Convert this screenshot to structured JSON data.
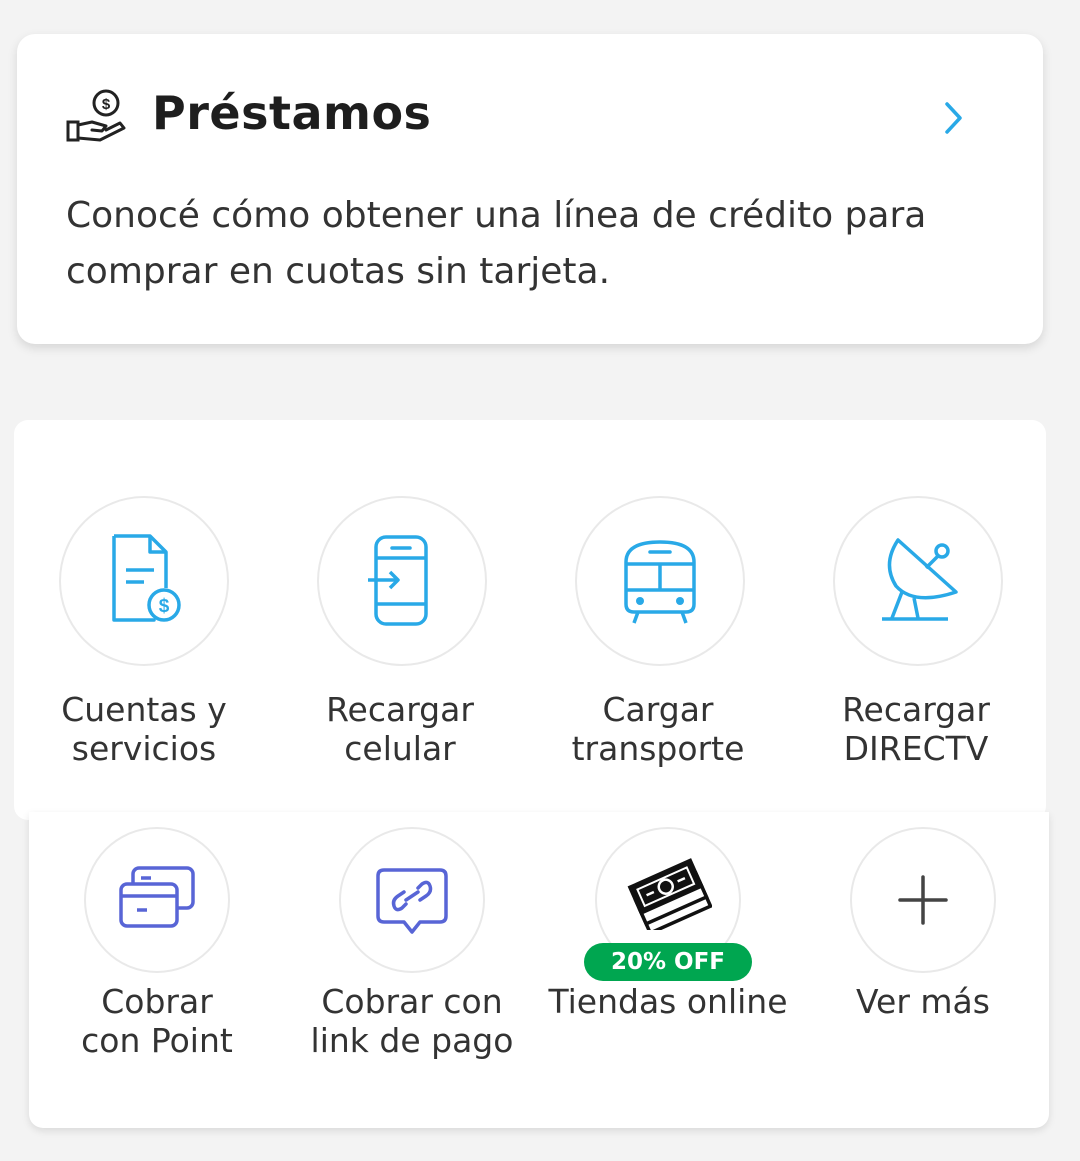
{
  "loans": {
    "title": "Préstamos",
    "description": "Conocé cómo obtener una línea de crédito para comprar en cuotas sin tarjeta.",
    "icon": "hand-money-icon",
    "chevron_icon": "chevron-right-icon"
  },
  "services": {
    "row1": [
      {
        "label": "Cuentas y\nservicios",
        "icon": "bill-document-icon"
      },
      {
        "label": "Recargar\ncelular",
        "icon": "phone-recharge-icon"
      },
      {
        "label": "Cargar\ntransporte",
        "icon": "train-icon"
      },
      {
        "label": "Recargar\nDIRECTV",
        "icon": "satellite-dish-icon"
      }
    ],
    "row2": [
      {
        "label": "Cobrar\ncon Point",
        "icon": "cards-icon"
      },
      {
        "label": "Cobrar con\nlink de pago",
        "icon": "payment-link-icon"
      },
      {
        "label": "Tiendas online",
        "icon": "money-stack-icon",
        "badge": "20% OFF"
      },
      {
        "label": "Ver más",
        "icon": "plus-icon"
      }
    ]
  },
  "colors": {
    "accent_blue": "#29a9e7",
    "link_purple": "#5865d6",
    "badge_green": "#00a650",
    "chevron": "#29a9e7"
  }
}
